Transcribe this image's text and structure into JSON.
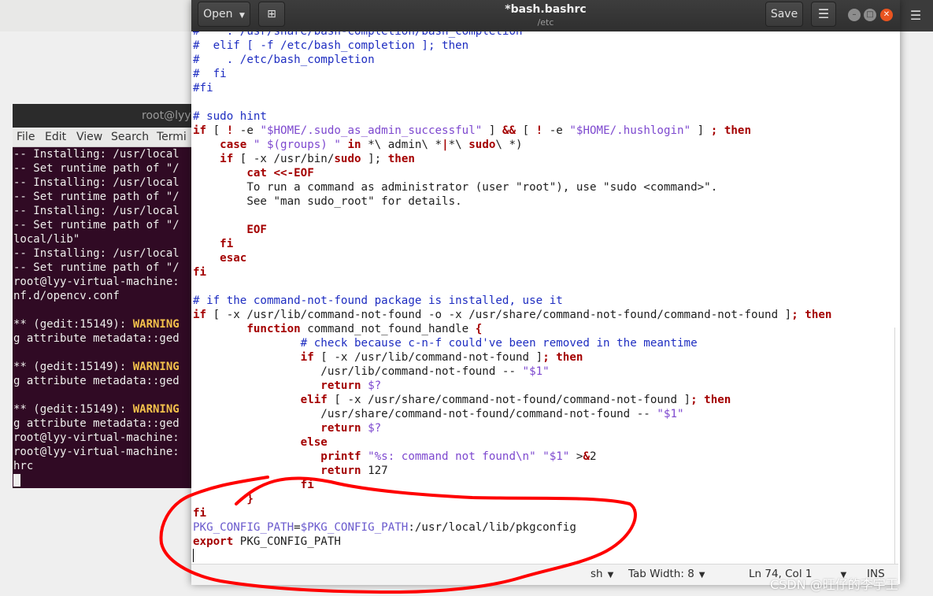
{
  "desktop_menu_icon": "hamburger-icon",
  "terminal": {
    "title": "root@lyy-v",
    "menu": [
      "File",
      "Edit",
      "View",
      "Search",
      "Termi"
    ],
    "lines": [
      {
        "text": "-- Installing: /usr/local",
        "warn": ""
      },
      {
        "text": "-- Set runtime path of \"/",
        "warn": ""
      },
      {
        "text": "-- Installing: /usr/local",
        "warn": ""
      },
      {
        "text": "-- Set runtime path of \"/",
        "warn": ""
      },
      {
        "text": "-- Installing: /usr/local",
        "warn": ""
      },
      {
        "text": "-- Set runtime path of \"/",
        "warn": ""
      },
      {
        "text": "local/lib\"",
        "warn": ""
      },
      {
        "text": "-- Installing: /usr/local",
        "warn": ""
      },
      {
        "text": "-- Set runtime path of \"/",
        "warn": ""
      },
      {
        "text": "root@lyy-virtual-machine:",
        "warn": ""
      },
      {
        "text": "nf.d/opencv.conf",
        "warn": ""
      },
      {
        "text": "",
        "warn": ""
      },
      {
        "text": "** (gedit:15149): ",
        "warn": "WARNING"
      },
      {
        "text": "g attribute metadata::ged",
        "warn": ""
      },
      {
        "text": "",
        "warn": ""
      },
      {
        "text": "** (gedit:15149): ",
        "warn": "WARNING"
      },
      {
        "text": "g attribute metadata::ged",
        "warn": ""
      },
      {
        "text": "",
        "warn": ""
      },
      {
        "text": "** (gedit:15149): ",
        "warn": "WARNING"
      },
      {
        "text": "g attribute metadata::ged",
        "warn": ""
      },
      {
        "text": "root@lyy-virtual-machine:",
        "warn": ""
      },
      {
        "text": "root@lyy-virtual-machine:",
        "warn": ""
      },
      {
        "text": "hrc",
        "warn": ""
      }
    ]
  },
  "gedit": {
    "title": "*bash.bashrc",
    "subtitle": "/etc",
    "open_label": "Open",
    "save_label": "Save",
    "code_lines": [
      [
        [
          "c",
          "#    . /usr/share/bash-completion/bash_completion"
        ]
      ],
      [
        [
          "c",
          "#  elif [ -f /etc/bash_completion ]; then"
        ]
      ],
      [
        [
          "c",
          "#    . /etc/bash_completion"
        ]
      ],
      [
        [
          "c",
          "#  fi"
        ]
      ],
      [
        [
          "c",
          "#fi"
        ]
      ],
      [],
      [
        [
          "c",
          "# sudo hint"
        ]
      ],
      [
        [
          "k",
          "if"
        ],
        [
          "o",
          " [ "
        ],
        [
          "k",
          "!"
        ],
        [
          "o",
          " -e "
        ],
        [
          "s",
          "\"$HOME/.sudo_as_admin_successful\""
        ],
        [
          "o",
          " ] "
        ],
        [
          "k",
          "&&"
        ],
        [
          "o",
          " [ "
        ],
        [
          "k",
          "!"
        ],
        [
          "o",
          " -e "
        ],
        [
          "s",
          "\"$HOME/.hushlogin\""
        ],
        [
          "o",
          " ] "
        ],
        [
          "k",
          "; then"
        ]
      ],
      [
        [
          "o",
          "    "
        ],
        [
          "k",
          "case"
        ],
        [
          "s",
          " \" $(groups) \" "
        ],
        [
          "k",
          "in"
        ],
        [
          "o",
          " *\\ admin\\ *"
        ],
        [
          "k",
          "|"
        ],
        [
          "o",
          "*\\ "
        ],
        [
          "k",
          "sudo"
        ],
        [
          "o",
          "\\ *)"
        ]
      ],
      [
        [
          "o",
          "    "
        ],
        [
          "k",
          "if"
        ],
        [
          "o",
          " [ -x /usr/bin/"
        ],
        [
          "k",
          "sudo"
        ],
        [
          "o",
          " ]; "
        ],
        [
          "k",
          "then"
        ]
      ],
      [
        [
          "o",
          "        "
        ],
        [
          "k",
          "cat <<-EOF"
        ]
      ],
      [
        [
          "o",
          "        To run a command as administrator (user \"root\"), use \"sudo <command>\"."
        ]
      ],
      [
        [
          "o",
          "        See \"man sudo_root\" for details."
        ]
      ],
      [],
      [
        [
          "o",
          "        "
        ],
        [
          "k",
          "EOF"
        ]
      ],
      [
        [
          "o",
          "    "
        ],
        [
          "k",
          "fi"
        ]
      ],
      [
        [
          "o",
          "    "
        ],
        [
          "k",
          "esac"
        ]
      ],
      [
        [
          "k",
          "fi"
        ]
      ],
      [],
      [
        [
          "c",
          "# if the command-not-found package is installed, use it"
        ]
      ],
      [
        [
          "k",
          "if"
        ],
        [
          "o",
          " [ -x /usr/lib/command-not-found -o -x /usr/share/command-not-found/command-not-found ]"
        ],
        [
          "k",
          "; then"
        ]
      ],
      [
        [
          "o",
          "        "
        ],
        [
          "k",
          "function"
        ],
        [
          "o",
          " command_not_found_handle "
        ],
        [
          "k",
          "{"
        ]
      ],
      [
        [
          "o",
          "                "
        ],
        [
          "c",
          "# check because c-n-f could've been removed in the meantime"
        ]
      ],
      [
        [
          "o",
          "                "
        ],
        [
          "k",
          "if"
        ],
        [
          "o",
          " [ -x /usr/lib/command-not-found ]"
        ],
        [
          "k",
          "; then"
        ]
      ],
      [
        [
          "o",
          "                   /usr/lib/command-not-found -- "
        ],
        [
          "s",
          "\"$1\""
        ]
      ],
      [
        [
          "o",
          "                   "
        ],
        [
          "k",
          "return"
        ],
        [
          "o",
          " "
        ],
        [
          "s",
          "$?"
        ]
      ],
      [
        [
          "o",
          "                "
        ],
        [
          "k",
          "elif"
        ],
        [
          "o",
          " [ -x /usr/share/command-not-found/command-not-found ]"
        ],
        [
          "k",
          "; then"
        ]
      ],
      [
        [
          "o",
          "                   /usr/share/command-not-found/command-not-found -- "
        ],
        [
          "s",
          "\"$1\""
        ]
      ],
      [
        [
          "o",
          "                   "
        ],
        [
          "k",
          "return"
        ],
        [
          "o",
          " "
        ],
        [
          "s",
          "$?"
        ]
      ],
      [
        [
          "o",
          "                "
        ],
        [
          "k",
          "else"
        ]
      ],
      [
        [
          "o",
          "                   "
        ],
        [
          "k",
          "printf"
        ],
        [
          "o",
          " "
        ],
        [
          "s",
          "\"%s: command not found\\n\""
        ],
        [
          "o",
          " "
        ],
        [
          "s",
          "\"$1\""
        ],
        [
          "o",
          " >"
        ],
        [
          "k",
          "&"
        ],
        [
          "o",
          "2"
        ]
      ],
      [
        [
          "o",
          "                   "
        ],
        [
          "k",
          "return"
        ],
        [
          "o",
          " 127"
        ]
      ],
      [
        [
          "o",
          "                "
        ],
        [
          "k",
          "fi"
        ]
      ],
      [
        [
          "o",
          "        "
        ],
        [
          "k",
          "}"
        ]
      ],
      [
        [
          "k",
          "fi"
        ]
      ],
      [
        [
          "v",
          "PKG_CONFIG_PATH"
        ],
        [
          "o",
          "="
        ],
        [
          "v",
          "$PKG_CONFIG_PATH"
        ],
        [
          "o",
          ":/usr/local/lib/pkgconfig"
        ]
      ],
      [
        [
          "k",
          "export"
        ],
        [
          "o",
          " PKG_CONFIG_PATH"
        ]
      ]
    ],
    "status": {
      "language": "sh",
      "tab_width": "Tab Width: 8",
      "position": "Ln 74, Col 1",
      "mode": "INS"
    }
  },
  "watermark": "CSDN @旺仔的李宇王",
  "colors": {
    "terminal_bg": "#300a24",
    "comment": "#1e2dc1",
    "keyword": "#a40000",
    "string": "#7d48cf",
    "annotation": "#ff0000",
    "close_button": "#e95420"
  }
}
